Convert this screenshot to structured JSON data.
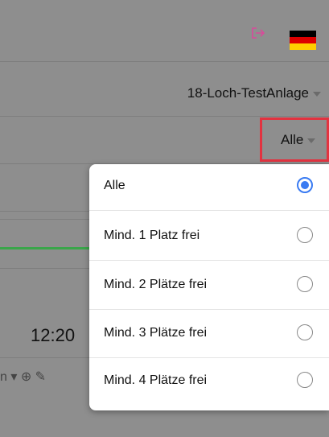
{
  "header": {
    "logout_icon": "logout-icon",
    "language_flag": "germany-flag",
    "flag_colors": [
      "#000000",
      "#dd0000",
      "#ffce00"
    ]
  },
  "course_selector": {
    "value": "18-Loch-TestAnlage"
  },
  "availability_filter": {
    "value": "Alle"
  },
  "slot": {
    "time": "12:20",
    "tools": "n ▾ ⊕ ✎"
  },
  "dropdown": {
    "options": [
      {
        "label": "Alle",
        "selected": true
      },
      {
        "label": "Mind. 1 Platz frei",
        "selected": false
      },
      {
        "label": "Mind. 2 Plätze frei",
        "selected": false
      },
      {
        "label": "Mind. 3 Plätze frei",
        "selected": false
      },
      {
        "label": "Mind. 4 Plätze frei",
        "selected": false
      }
    ]
  },
  "colors": {
    "accent": "#3a7bf2",
    "highlight": "#e33340",
    "progress": "#3aa64a"
  }
}
